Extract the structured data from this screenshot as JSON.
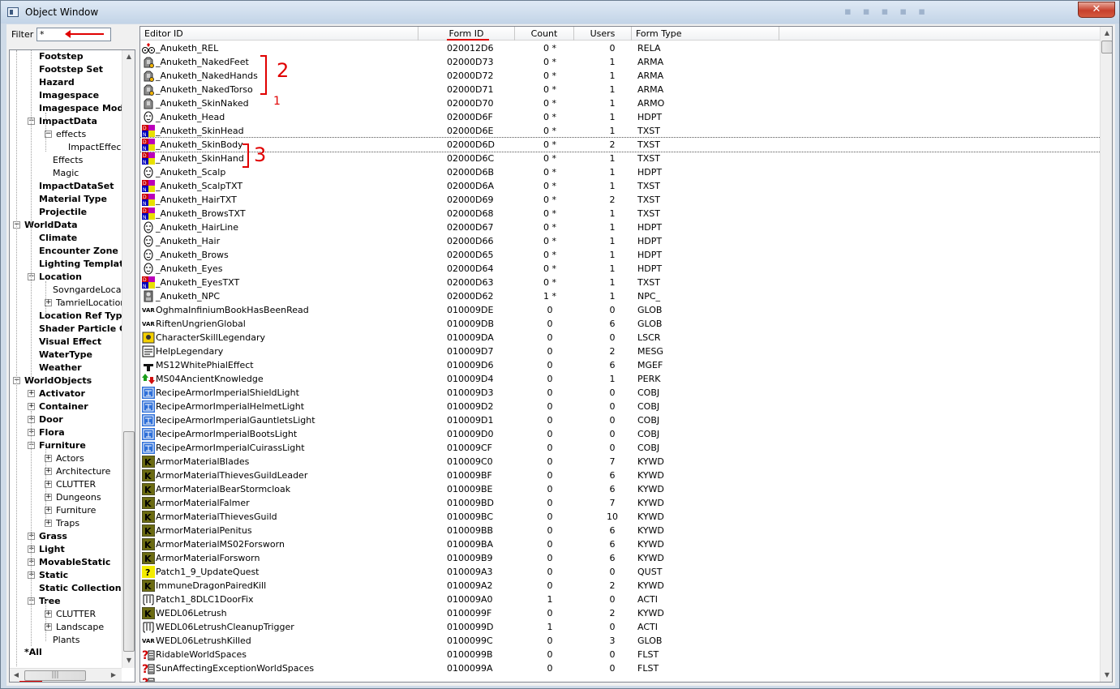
{
  "window": {
    "title": "Object Window"
  },
  "filter": {
    "label": "Filter",
    "value": "*"
  },
  "tree": {
    "items": [
      {
        "label": "Footstep",
        "depth": 2,
        "bold": true
      },
      {
        "label": "Footstep Set",
        "depth": 2,
        "bold": true
      },
      {
        "label": "Hazard",
        "depth": 2,
        "bold": true
      },
      {
        "label": "Imagespace",
        "depth": 2,
        "bold": true
      },
      {
        "label": "Imagespace Mod",
        "depth": 2,
        "bold": true
      },
      {
        "label": "ImpactData",
        "depth": 2,
        "bold": true,
        "expander": "−"
      },
      {
        "label": "effects",
        "depth": 3,
        "bold": false,
        "expander": "−"
      },
      {
        "label": "ImpactEffec",
        "depth": 4,
        "bold": false
      },
      {
        "label": "Effects",
        "depth": 3,
        "bold": false
      },
      {
        "label": "Magic",
        "depth": 3,
        "bold": false
      },
      {
        "label": "ImpactDataSet",
        "depth": 2,
        "bold": true
      },
      {
        "label": "Material Type",
        "depth": 2,
        "bold": true
      },
      {
        "label": "Projectile",
        "depth": 2,
        "bold": true
      },
      {
        "label": "WorldData",
        "depth": 1,
        "bold": true,
        "expander": "−"
      },
      {
        "label": "Climate",
        "depth": 2,
        "bold": true
      },
      {
        "label": "Encounter Zone",
        "depth": 2,
        "bold": true
      },
      {
        "label": "Lighting Templat",
        "depth": 2,
        "bold": true
      },
      {
        "label": "Location",
        "depth": 2,
        "bold": true,
        "expander": "−"
      },
      {
        "label": "SovngardeLoca",
        "depth": 3,
        "bold": false
      },
      {
        "label": "TamrielLocation",
        "depth": 3,
        "bold": false,
        "expander": "+"
      },
      {
        "label": "Location Ref Typ",
        "depth": 2,
        "bold": true
      },
      {
        "label": "Shader Particle G",
        "depth": 2,
        "bold": true
      },
      {
        "label": "Visual Effect",
        "depth": 2,
        "bold": true
      },
      {
        "label": "WaterType",
        "depth": 2,
        "bold": true
      },
      {
        "label": "Weather",
        "depth": 2,
        "bold": true
      },
      {
        "label": "WorldObjects",
        "depth": 1,
        "bold": true,
        "expander": "−"
      },
      {
        "label": "Activator",
        "depth": 2,
        "bold": true,
        "expander": "+"
      },
      {
        "label": "Container",
        "depth": 2,
        "bold": true,
        "expander": "+"
      },
      {
        "label": "Door",
        "depth": 2,
        "bold": true,
        "expander": "+"
      },
      {
        "label": "Flora",
        "depth": 2,
        "bold": true,
        "expander": "+"
      },
      {
        "label": "Furniture",
        "depth": 2,
        "bold": true,
        "expander": "−"
      },
      {
        "label": "Actors",
        "depth": 3,
        "bold": false,
        "expander": "+"
      },
      {
        "label": "Architecture",
        "depth": 3,
        "bold": false,
        "expander": "+"
      },
      {
        "label": "CLUTTER",
        "depth": 3,
        "bold": false,
        "expander": "+"
      },
      {
        "label": "Dungeons",
        "depth": 3,
        "bold": false,
        "expander": "+"
      },
      {
        "label": "Furniture",
        "depth": 3,
        "bold": false,
        "expander": "+"
      },
      {
        "label": "Traps",
        "depth": 3,
        "bold": false,
        "expander": "+"
      },
      {
        "label": "Grass",
        "depth": 2,
        "bold": true,
        "expander": "+"
      },
      {
        "label": "Light",
        "depth": 2,
        "bold": true,
        "expander": "+"
      },
      {
        "label": "MovableStatic",
        "depth": 2,
        "bold": true,
        "expander": "+"
      },
      {
        "label": "Static",
        "depth": 2,
        "bold": true,
        "expander": "+"
      },
      {
        "label": "Static Collection",
        "depth": 2,
        "bold": true
      },
      {
        "label": "Tree",
        "depth": 2,
        "bold": true,
        "expander": "−"
      },
      {
        "label": "CLUTTER",
        "depth": 3,
        "bold": false,
        "expander": "+"
      },
      {
        "label": "Landscape",
        "depth": 3,
        "bold": false,
        "expander": "+"
      },
      {
        "label": "Plants",
        "depth": 3,
        "bold": false
      },
      {
        "label": "",
        "depth": 0,
        "bold": false
      },
      {
        "label": "*All",
        "depth": 1,
        "bold": true
      }
    ]
  },
  "list": {
    "columns": [
      "Editor ID",
      "Form ID",
      "Count",
      "Users",
      "Form Type"
    ],
    "rows": [
      {
        "icon": "relationship-icon",
        "editor_id": "_Anuketh_REL",
        "form_id": "020012D6",
        "count": "0 *",
        "users": "0",
        "form_type": "RELA"
      },
      {
        "icon": "armor-addon-icon",
        "editor_id": "_Anuketh_NakedFeet",
        "form_id": "02000D73",
        "count": "0 *",
        "users": "1",
        "form_type": "ARMA"
      },
      {
        "icon": "armor-addon-icon",
        "editor_id": "_Anuketh_NakedHands",
        "form_id": "02000D72",
        "count": "0 *",
        "users": "1",
        "form_type": "ARMA"
      },
      {
        "icon": "armor-addon-icon",
        "editor_id": "_Anuketh_NakedTorso",
        "form_id": "02000D71",
        "count": "0 *",
        "users": "1",
        "form_type": "ARMA"
      },
      {
        "icon": "armor-icon",
        "editor_id": "_Anuketh_SkinNaked",
        "form_id": "02000D70",
        "count": "0 *",
        "users": "1",
        "form_type": "ARMO"
      },
      {
        "icon": "head-part-icon",
        "editor_id": "_Anuketh_Head",
        "form_id": "02000D6F",
        "count": "0 *",
        "users": "1",
        "form_type": "HDPT"
      },
      {
        "icon": "texture-set-icon",
        "editor_id": "_Anuketh_SkinHead",
        "form_id": "02000D6E",
        "count": "0 *",
        "users": "1",
        "form_type": "TXST"
      },
      {
        "icon": "texture-set-icon",
        "editor_id": "_Anuketh_SkinBody",
        "form_id": "02000D6D",
        "count": "0 *",
        "users": "2",
        "form_type": "TXST",
        "focused": true
      },
      {
        "icon": "texture-set-icon",
        "editor_id": "_Anuketh_SkinHand",
        "form_id": "02000D6C",
        "count": "0 *",
        "users": "1",
        "form_type": "TXST"
      },
      {
        "icon": "head-part-icon",
        "editor_id": "_Anuketh_Scalp",
        "form_id": "02000D6B",
        "count": "0 *",
        "users": "1",
        "form_type": "HDPT"
      },
      {
        "icon": "texture-set-icon",
        "editor_id": "_Anuketh_ScalpTXT",
        "form_id": "02000D6A",
        "count": "0 *",
        "users": "1",
        "form_type": "TXST"
      },
      {
        "icon": "texture-set-icon",
        "editor_id": "_Anuketh_HairTXT",
        "form_id": "02000D69",
        "count": "0 *",
        "users": "2",
        "form_type": "TXST"
      },
      {
        "icon": "texture-set-icon",
        "editor_id": "_Anuketh_BrowsTXT",
        "form_id": "02000D68",
        "count": "0 *",
        "users": "1",
        "form_type": "TXST"
      },
      {
        "icon": "head-part-icon",
        "editor_id": "_Anuketh_HairLine",
        "form_id": "02000D67",
        "count": "0 *",
        "users": "1",
        "form_type": "HDPT"
      },
      {
        "icon": "head-part-icon",
        "editor_id": "_Anuketh_Hair",
        "form_id": "02000D66",
        "count": "0 *",
        "users": "1",
        "form_type": "HDPT"
      },
      {
        "icon": "head-part-icon",
        "editor_id": "_Anuketh_Brows",
        "form_id": "02000D65",
        "count": "0 *",
        "users": "1",
        "form_type": "HDPT"
      },
      {
        "icon": "head-part-icon",
        "editor_id": "_Anuketh_Eyes",
        "form_id": "02000D64",
        "count": "0 *",
        "users": "1",
        "form_type": "HDPT"
      },
      {
        "icon": "texture-set-icon",
        "editor_id": "_Anuketh_EyesTXT",
        "form_id": "02000D63",
        "count": "0 *",
        "users": "1",
        "form_type": "TXST"
      },
      {
        "icon": "npc-icon",
        "editor_id": "_Anuketh_NPC",
        "form_id": "02000D62",
        "count": "1 *",
        "users": "1",
        "form_type": "NPC_"
      },
      {
        "icon": "global-var-icon",
        "editor_id": "OghmaInfiniumBookHasBeenRead",
        "form_id": "010009DE",
        "count": "0",
        "users": "0",
        "form_type": "GLOB"
      },
      {
        "icon": "global-var-icon",
        "editor_id": "RiftenUngrienGlobal",
        "form_id": "010009DB",
        "count": "0",
        "users": "6",
        "form_type": "GLOB"
      },
      {
        "icon": "load-screen-icon",
        "editor_id": "CharacterSkillLegendary",
        "form_id": "010009DA",
        "count": "0",
        "users": "0",
        "form_type": "LSCR"
      },
      {
        "icon": "message-icon",
        "editor_id": "HelpLegendary",
        "form_id": "010009D7",
        "count": "0",
        "users": "2",
        "form_type": "MESG"
      },
      {
        "icon": "magic-effect-icon",
        "editor_id": "MS12WhitePhialEffect",
        "form_id": "010009D6",
        "count": "0",
        "users": "6",
        "form_type": "MGEF"
      },
      {
        "icon": "perk-icon",
        "editor_id": "MS04AncientKnowledge",
        "form_id": "010009D4",
        "count": "0",
        "users": "1",
        "form_type": "PERK"
      },
      {
        "icon": "constructible-icon",
        "editor_id": "RecipeArmorImperialShieldLight",
        "form_id": "010009D3",
        "count": "0",
        "users": "0",
        "form_type": "COBJ"
      },
      {
        "icon": "constructible-icon",
        "editor_id": "RecipeArmorImperialHelmetLight",
        "form_id": "010009D2",
        "count": "0",
        "users": "0",
        "form_type": "COBJ"
      },
      {
        "icon": "constructible-icon",
        "editor_id": "RecipeArmorImperialGauntletsLight",
        "form_id": "010009D1",
        "count": "0",
        "users": "0",
        "form_type": "COBJ"
      },
      {
        "icon": "constructible-icon",
        "editor_id": "RecipeArmorImperialBootsLight",
        "form_id": "010009D0",
        "count": "0",
        "users": "0",
        "form_type": "COBJ"
      },
      {
        "icon": "constructible-icon",
        "editor_id": "RecipeArmorImperialCuirassLight",
        "form_id": "010009CF",
        "count": "0",
        "users": "0",
        "form_type": "COBJ"
      },
      {
        "icon": "keyword-icon",
        "editor_id": "ArmorMaterialBlades",
        "form_id": "010009C0",
        "count": "0",
        "users": "7",
        "form_type": "KYWD"
      },
      {
        "icon": "keyword-icon",
        "editor_id": "ArmorMaterialThievesGuildLeader",
        "form_id": "010009BF",
        "count": "0",
        "users": "6",
        "form_type": "KYWD"
      },
      {
        "icon": "keyword-icon",
        "editor_id": "ArmorMaterialBearStormcloak",
        "form_id": "010009BE",
        "count": "0",
        "users": "6",
        "form_type": "KYWD"
      },
      {
        "icon": "keyword-icon",
        "editor_id": "ArmorMaterialFalmer",
        "form_id": "010009BD",
        "count": "0",
        "users": "7",
        "form_type": "KYWD"
      },
      {
        "icon": "keyword-icon",
        "editor_id": "ArmorMaterialThievesGuild",
        "form_id": "010009BC",
        "count": "0",
        "users": "10",
        "form_type": "KYWD"
      },
      {
        "icon": "keyword-icon",
        "editor_id": "ArmorMaterialPenitus",
        "form_id": "010009BB",
        "count": "0",
        "users": "6",
        "form_type": "KYWD"
      },
      {
        "icon": "keyword-icon",
        "editor_id": "ArmorMaterialMS02Forsworn",
        "form_id": "010009BA",
        "count": "0",
        "users": "6",
        "form_type": "KYWD"
      },
      {
        "icon": "keyword-icon",
        "editor_id": "ArmorMaterialForsworn",
        "form_id": "010009B9",
        "count": "0",
        "users": "6",
        "form_type": "KYWD"
      },
      {
        "icon": "quest-icon",
        "editor_id": "Patch1_9_UpdateQuest",
        "form_id": "010009A3",
        "count": "0",
        "users": "0",
        "form_type": "QUST"
      },
      {
        "icon": "keyword-icon",
        "editor_id": "ImmuneDragonPairedKill",
        "form_id": "010009A2",
        "count": "0",
        "users": "2",
        "form_type": "KYWD"
      },
      {
        "icon": "activator-icon",
        "editor_id": "Patch1_8DLC1DoorFix",
        "form_id": "010009A0",
        "count": "1",
        "users": "0",
        "form_type": "ACTI"
      },
      {
        "icon": "keyword-icon",
        "editor_id": "WEDL06Letrush",
        "form_id": "0100099F",
        "count": "0",
        "users": "2",
        "form_type": "KYWD"
      },
      {
        "icon": "activator-icon",
        "editor_id": "WEDL06LetrushCleanupTrigger",
        "form_id": "0100099D",
        "count": "1",
        "users": "0",
        "form_type": "ACTI"
      },
      {
        "icon": "global-var-icon",
        "editor_id": "WEDL06LetrushKilled",
        "form_id": "0100099C",
        "count": "0",
        "users": "3",
        "form_type": "GLOB"
      },
      {
        "icon": "form-list-icon",
        "editor_id": "RidableWorldSpaces",
        "form_id": "0100099B",
        "count": "0",
        "users": "0",
        "form_type": "FLST"
      },
      {
        "icon": "form-list-icon",
        "editor_id": "SunAffectingExceptionWorldSpaces",
        "form_id": "0100099A",
        "count": "0",
        "users": "0",
        "form_type": "FLST"
      },
      {
        "icon": "form-list-icon",
        "editor_id": "",
        "form_id": "",
        "count": "",
        "users": "",
        "form_type": ""
      }
    ]
  },
  "annotations": {
    "group2": "2",
    "group1": "1",
    "group3": "3"
  },
  "colors": {
    "annotation": "#e00000",
    "titlebar": "#c3d4e7",
    "keyword": "#6b6b12"
  }
}
